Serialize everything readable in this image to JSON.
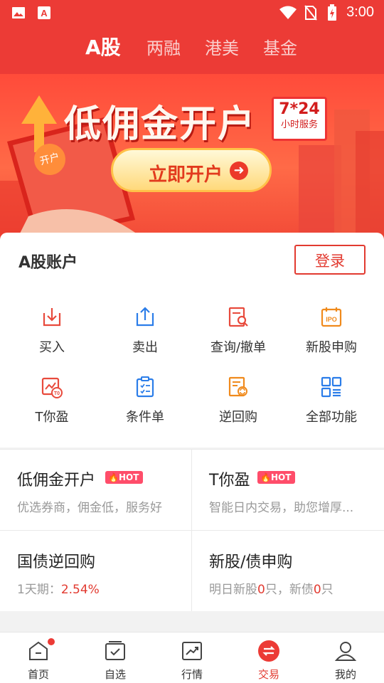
{
  "status_bar": {
    "time": "3:00"
  },
  "header": {
    "tabs": [
      {
        "label": "A股",
        "active": true
      },
      {
        "label": "两融",
        "active": false
      },
      {
        "label": "港美",
        "active": false
      },
      {
        "label": "基金",
        "active": false
      }
    ]
  },
  "banner": {
    "title": "低佣金开户",
    "badge_top": "7*24",
    "badge_bottom": "小时服务",
    "cta_label": "立即开户",
    "phone_chip": "开户"
  },
  "account": {
    "title": "A股账户",
    "login_label": "登录",
    "functions": [
      {
        "label": "买入",
        "icon": "buy-icon"
      },
      {
        "label": "卖出",
        "icon": "sell-icon"
      },
      {
        "label": "查询/撤单",
        "icon": "query-cancel-icon"
      },
      {
        "label": "新股申购",
        "icon": "ipo-icon"
      },
      {
        "label": "T你盈",
        "icon": "t-profit-icon"
      },
      {
        "label": "条件单",
        "icon": "conditional-order-icon"
      },
      {
        "label": "逆回购",
        "icon": "reverse-repo-icon"
      },
      {
        "label": "全部功能",
        "icon": "all-functions-icon"
      }
    ]
  },
  "promos": {
    "low_commission": {
      "title": "低佣金开户",
      "tag": "HOT",
      "subtitle": "优选券商，佣金低，服务好"
    },
    "t_profit": {
      "title": "T你盈",
      "tag": "HOT",
      "subtitle": "智能日内交易，助您增厚..."
    },
    "bond_repo": {
      "title": "国债逆回购",
      "subtitle_prefix": "1天期：",
      "rate": "2.54%"
    },
    "ipo_bond": {
      "title": "新股/债申购",
      "p1": "明日新股",
      "n1": "0",
      "p2": "只，新债",
      "n2": "0",
      "p3": "只"
    }
  },
  "nav": {
    "items": [
      {
        "label": "首页",
        "icon": "home-icon"
      },
      {
        "label": "自选",
        "icon": "watchlist-icon"
      },
      {
        "label": "行情",
        "icon": "market-icon"
      },
      {
        "label": "交易",
        "icon": "trade-icon"
      },
      {
        "label": "我的",
        "icon": "profile-icon"
      }
    ]
  },
  "colors": {
    "brand_red": "#ec3b36",
    "hot_pink": "#ff4d6a"
  }
}
